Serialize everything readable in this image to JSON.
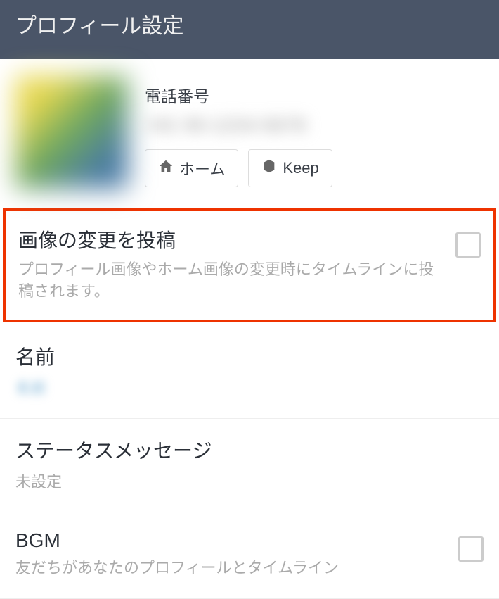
{
  "header": {
    "title": "プロフィール設定"
  },
  "profile": {
    "phone_label": "電話番号",
    "phone_value": "+81 90-1234-5678",
    "home_button": "ホーム",
    "keep_button": "Keep"
  },
  "sections": {
    "image_change": {
      "title": "画像の変更を投稿",
      "description": "プロフィール画像やホーム画像の変更時にタイムラインに投稿されます。"
    },
    "name": {
      "title": "名前",
      "value": "名前"
    },
    "status": {
      "title": "ステータスメッセージ",
      "value": "未設定"
    },
    "bgm": {
      "title": "BGM",
      "description": "友だちがあなたのプロフィールとタイムライン"
    }
  }
}
